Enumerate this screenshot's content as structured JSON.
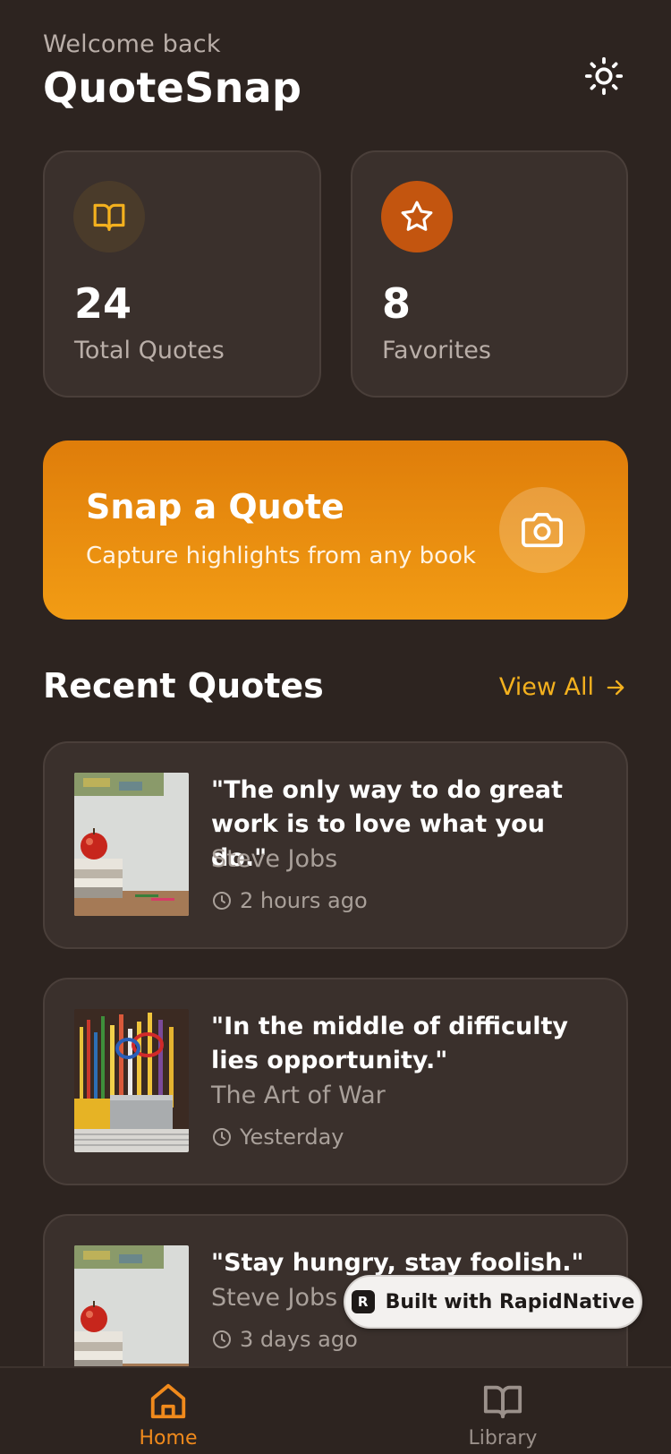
{
  "header": {
    "welcome": "Welcome back",
    "app_title": "QuoteSnap",
    "theme_icon": "sun-icon"
  },
  "stats": [
    {
      "icon": "book-icon",
      "value": "24",
      "label": "Total Quotes"
    },
    {
      "icon": "star-icon",
      "value": "8",
      "label": "Favorites"
    }
  ],
  "snap": {
    "title": "Snap a Quote",
    "subtitle": "Capture highlights from any book",
    "icon": "camera-icon"
  },
  "recent": {
    "title": "Recent Quotes",
    "view_all": "View All"
  },
  "quotes": [
    {
      "text": "\"The only way to do great work is to love what you do.\"",
      "author": "Steve Jobs",
      "time": "2 hours ago",
      "thumb": "apple-books-photo"
    },
    {
      "text": "\"In the middle of difficulty lies opportunity.\"",
      "author": "The Art of War",
      "time": "Yesterday",
      "thumb": "pencils-cup-photo"
    },
    {
      "text": "\"Stay hungry, stay foolish.\"",
      "author": "Steve Jobs",
      "time": "3 days ago",
      "thumb": "apple-books-photo"
    }
  ],
  "badge": {
    "label": "Built with RapidNative",
    "logo": "R"
  },
  "nav": [
    {
      "label": "Home",
      "icon": "home-icon",
      "active": true
    },
    {
      "label": "Library",
      "icon": "library-icon",
      "active": false
    }
  ],
  "colors": {
    "background": "#2d2420",
    "card": "#3a302c",
    "accent": "#f4b11e",
    "snap_gradient_top": "#df7d0a",
    "snap_gradient_bottom": "#f29c14",
    "favorite": "#c3550f",
    "nav_active": "#f08a1c"
  }
}
